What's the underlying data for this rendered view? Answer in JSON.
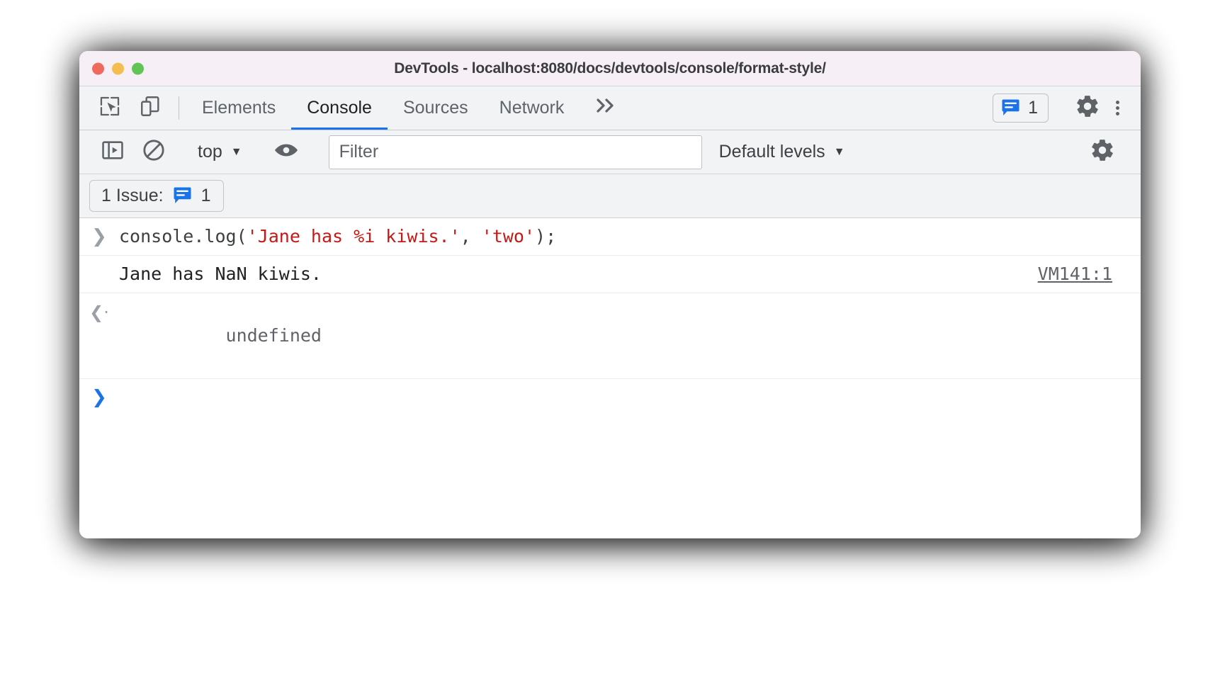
{
  "window": {
    "title": "DevTools - localhost:8080/docs/devtools/console/format-style/",
    "traffic_lights": {
      "close": "close-window",
      "minimize": "minimize-window",
      "maximize": "maximize-window"
    }
  },
  "tabstrip": {
    "inspect_icon": "inspect-element-icon",
    "device_toggle_icon": "device-toolbar-icon",
    "tabs": [
      {
        "label": "Elements",
        "active": false
      },
      {
        "label": "Console",
        "active": true
      },
      {
        "label": "Sources",
        "active": false
      },
      {
        "label": "Network",
        "active": false
      }
    ],
    "more_tabs_label": "»",
    "issues_badge": {
      "icon": "issues-message-icon",
      "count": "1"
    },
    "settings_icon": "gear-icon",
    "more_options_icon": "kebab-menu-icon"
  },
  "console_toolbar": {
    "sidebar_toggle_icon": "console-sidebar-icon",
    "clear_console_icon": "clear-console-icon",
    "context": {
      "label": "top",
      "caret": "▼"
    },
    "live_expression_icon": "eye-icon",
    "filter": {
      "placeholder": "Filter",
      "value": ""
    },
    "levels": {
      "label": "Default levels",
      "caret": "▼"
    },
    "settings_icon": "gear-icon"
  },
  "issues_bar": {
    "chip_label": "1 Issue:",
    "chip_icon": "issues-message-icon",
    "chip_count": "1"
  },
  "console": {
    "rows": [
      {
        "type": "input",
        "gutter_icon": "prompt-chevron-icon",
        "segments": [
          {
            "text": "console.log(",
            "kind": "plain"
          },
          {
            "text": "'Jane has %i kiwis.'",
            "kind": "string"
          },
          {
            "text": ", ",
            "kind": "plain"
          },
          {
            "text": "'two'",
            "kind": "string"
          },
          {
            "text": ");",
            "kind": "plain"
          }
        ]
      },
      {
        "type": "log",
        "text": "Jane has NaN kiwis.",
        "source": "VM141:1"
      },
      {
        "type": "result",
        "gutter_icon": "return-value-icon",
        "text": "undefined"
      },
      {
        "type": "prompt",
        "gutter_icon": "prompt-chevron-icon",
        "text": ""
      }
    ]
  },
  "colors": {
    "accent": "#1a73e8",
    "string": "#c41a16",
    "toolbar_bg": "#f1f3f4",
    "titlebar_bg": "#f6eff6"
  }
}
